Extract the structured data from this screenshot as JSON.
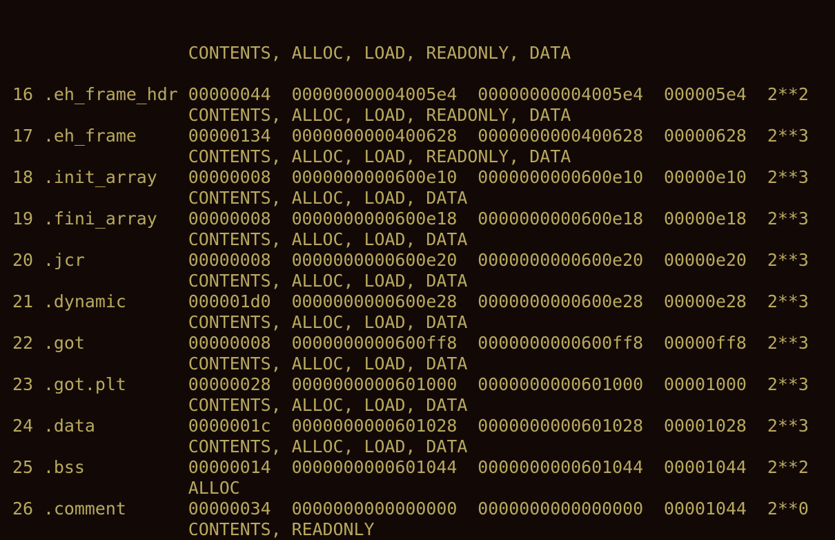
{
  "terminal": {
    "leading_flags": "CONTENTS, ALLOC, LOAD, READONLY, DATA",
    "sections": [
      {
        "idx": "16",
        "name": ".eh_frame_hdr",
        "size": "00000044",
        "vma": "00000000004005e4",
        "lma": "00000000004005e4",
        "fileoff": "000005e4",
        "algn": "2**2",
        "flags": "CONTENTS, ALLOC, LOAD, READONLY, DATA"
      },
      {
        "idx": "17",
        "name": ".eh_frame",
        "size": "00000134",
        "vma": "0000000000400628",
        "lma": "0000000000400628",
        "fileoff": "00000628",
        "algn": "2**3",
        "flags": "CONTENTS, ALLOC, LOAD, READONLY, DATA"
      },
      {
        "idx": "18",
        "name": ".init_array",
        "size": "00000008",
        "vma": "0000000000600e10",
        "lma": "0000000000600e10",
        "fileoff": "00000e10",
        "algn": "2**3",
        "flags": "CONTENTS, ALLOC, LOAD, DATA"
      },
      {
        "idx": "19",
        "name": ".fini_array",
        "size": "00000008",
        "vma": "0000000000600e18",
        "lma": "0000000000600e18",
        "fileoff": "00000e18",
        "algn": "2**3",
        "flags": "CONTENTS, ALLOC, LOAD, DATA"
      },
      {
        "idx": "20",
        "name": ".jcr",
        "size": "00000008",
        "vma": "0000000000600e20",
        "lma": "0000000000600e20",
        "fileoff": "00000e20",
        "algn": "2**3",
        "flags": "CONTENTS, ALLOC, LOAD, DATA"
      },
      {
        "idx": "21",
        "name": ".dynamic",
        "size": "000001d0",
        "vma": "0000000000600e28",
        "lma": "0000000000600e28",
        "fileoff": "00000e28",
        "algn": "2**3",
        "flags": "CONTENTS, ALLOC, LOAD, DATA"
      },
      {
        "idx": "22",
        "name": ".got",
        "size": "00000008",
        "vma": "0000000000600ff8",
        "lma": "0000000000600ff8",
        "fileoff": "00000ff8",
        "algn": "2**3",
        "flags": "CONTENTS, ALLOC, LOAD, DATA"
      },
      {
        "idx": "23",
        "name": ".got.plt",
        "size": "00000028",
        "vma": "0000000000601000",
        "lma": "0000000000601000",
        "fileoff": "00001000",
        "algn": "2**3",
        "flags": "CONTENTS, ALLOC, LOAD, DATA"
      },
      {
        "idx": "24",
        "name": ".data",
        "size": "0000001c",
        "vma": "0000000000601028",
        "lma": "0000000000601028",
        "fileoff": "00001028",
        "algn": "2**3",
        "flags": "CONTENTS, ALLOC, LOAD, DATA"
      },
      {
        "idx": "25",
        "name": ".bss",
        "size": "00000014",
        "vma": "0000000000601044",
        "lma": "0000000000601044",
        "fileoff": "00001044",
        "algn": "2**2",
        "flags": "ALLOC"
      },
      {
        "idx": "26",
        "name": ".comment",
        "size": "00000034",
        "vma": "0000000000000000",
        "lma": "0000000000000000",
        "fileoff": "00001044",
        "algn": "2**0",
        "flags": "CONTENTS, READONLY"
      }
    ]
  },
  "colors": {
    "background": "#120907",
    "text": "#b9a95e"
  }
}
